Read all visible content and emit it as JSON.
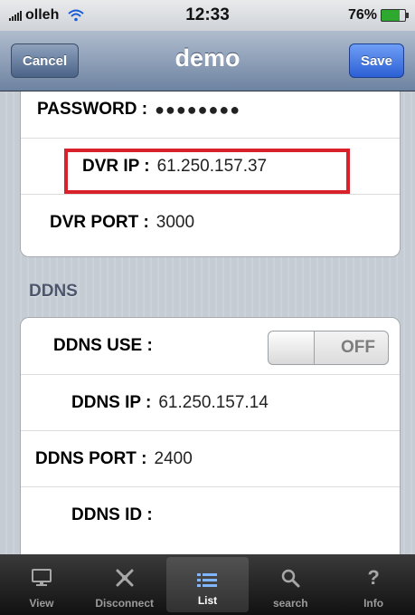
{
  "status": {
    "carrier": "olleh",
    "time": "12:33",
    "battery": "76%"
  },
  "nav": {
    "title": "demo",
    "cancel_label": "Cancel",
    "save_label": "Save"
  },
  "group1": {
    "rows": [
      {
        "label": "PASSWORD :",
        "value": "●●●●●●●●"
      },
      {
        "label": "DVR IP :",
        "value": "61.250.157.37"
      },
      {
        "label": "DVR PORT :",
        "value": "3000"
      }
    ]
  },
  "ddns": {
    "header": "DDNS",
    "use_label": "DDNS USE :",
    "toggle_text": "OFF",
    "ip_label": "DDNS IP :",
    "ip_value": "61.250.157.14",
    "port_label": "DDNS PORT :",
    "port_value": "2400",
    "id_label": "DDNS ID :",
    "id_value": ""
  },
  "tabs": [
    {
      "label": "View",
      "icon": "monitor-icon"
    },
    {
      "label": "Disconnect",
      "icon": "disconnect-icon"
    },
    {
      "label": "List",
      "icon": "list-icon"
    },
    {
      "label": "search",
      "icon": "search-icon"
    },
    {
      "label": "Info",
      "icon": "question-icon"
    }
  ],
  "colors": {
    "highlight": "#d8212b",
    "save": "#2b60d4",
    "nav": "#6d83a2"
  }
}
